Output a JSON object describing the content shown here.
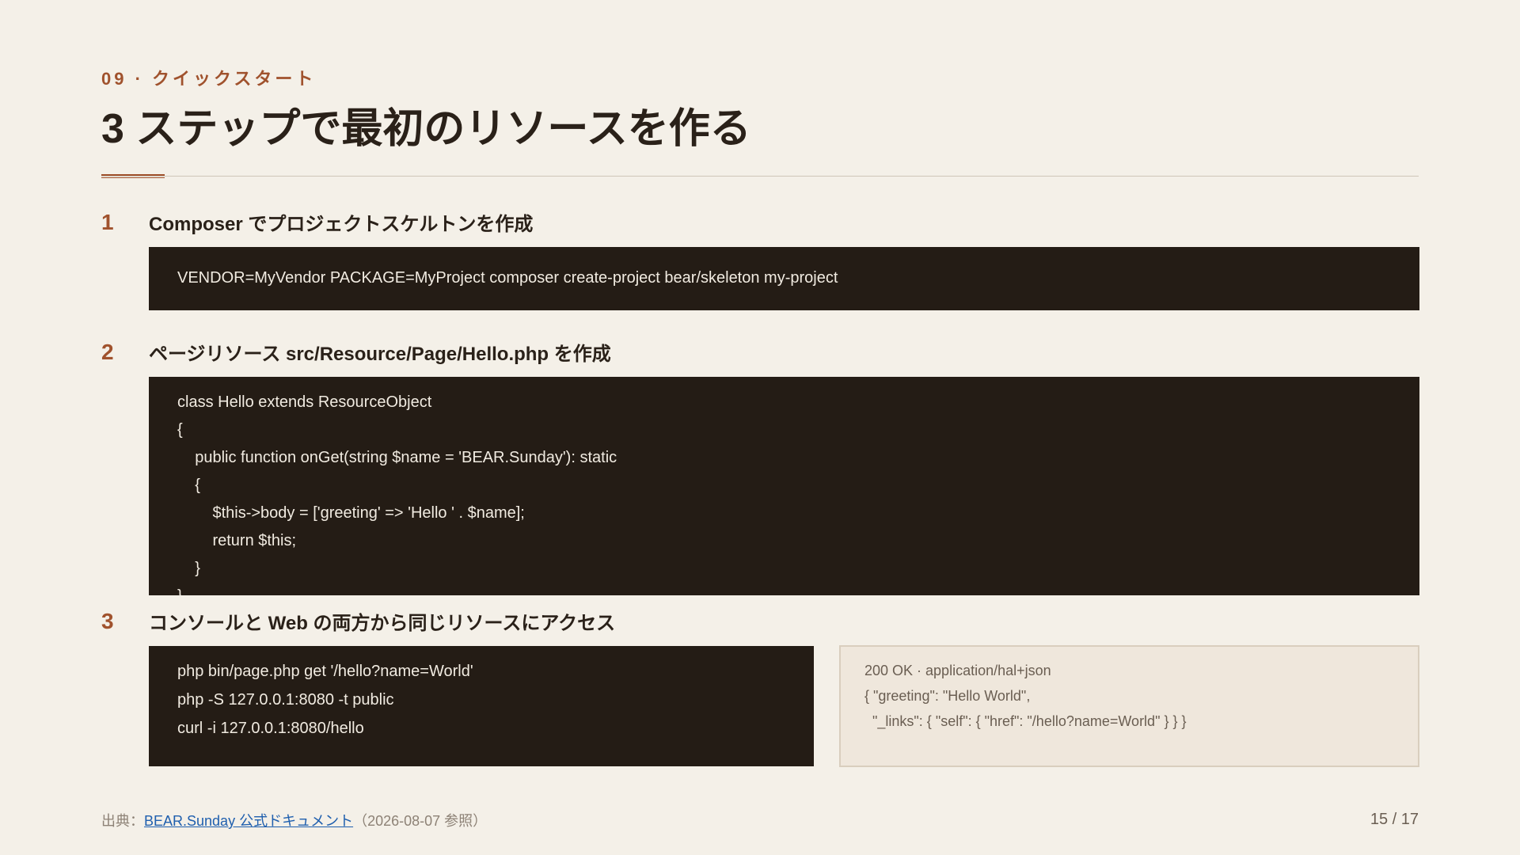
{
  "header": {
    "kicker": "09 · クイックスタート",
    "title": "3 ステップで最初のリソースを作る"
  },
  "steps": [
    {
      "number": "1",
      "title": "Composer でプロジェクトスケルトンを作成",
      "code": [
        "VENDOR=MyVendor PACKAGE=MyProject composer create-project bear/skeleton my-project"
      ]
    },
    {
      "number": "2",
      "title": "ページリソース src/Resource/Page/Hello.php を作成",
      "code": [
        "class Hello extends ResourceObject",
        "{",
        "    public function onGet(string $name = 'BEAR.Sunday'): static",
        "    {",
        "        $this->body = ['greeting' => 'Hello ' . $name];",
        "        return $this;",
        "    }",
        "}"
      ]
    },
    {
      "number": "3",
      "title": "コンソールと Web の両方から同じリソースにアクセス",
      "code": [
        "php bin/page.php get '/hello?name=World'",
        "php -S 127.0.0.1:8080 -t public",
        "curl -i 127.0.0.1:8080/hello"
      ],
      "response": [
        "200 OK · application/hal+json",
        "{ \"greeting\": \"Hello World\",",
        "  \"_links\": { \"self\": { \"href\": \"/hello?name=World\" } } }"
      ]
    }
  ],
  "footer": {
    "source_prefix": "出典：",
    "source_link": "BEAR.Sunday 公式ドキュメント",
    "source_suffix": "（2026-08-07 参照）",
    "page": "15 / 17"
  },
  "colors": {
    "accent": "#a0522d",
    "background": "#f4f0e8",
    "code_bg": "#241c15",
    "link": "#1f5fae"
  }
}
